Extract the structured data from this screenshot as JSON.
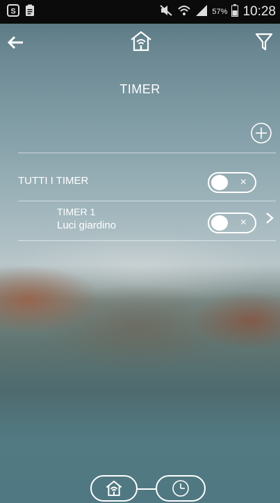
{
  "status_bar": {
    "battery_percent": "57%",
    "time": "10:28"
  },
  "header": {
    "title": "TIMER"
  },
  "all_timers": {
    "label": "TUTTI I TIMER",
    "toggle_symbol": "×"
  },
  "timers": [
    {
      "name": "TIMER 1",
      "description": "Luci giardino",
      "toggle_symbol": "×"
    }
  ],
  "icons": {
    "back": "arrow-left",
    "home": "home-wifi",
    "filter": "funnel",
    "add": "plus-circle",
    "chevron": "chevron-right",
    "nav_home": "home-wifi",
    "nav_clock": "clock"
  }
}
